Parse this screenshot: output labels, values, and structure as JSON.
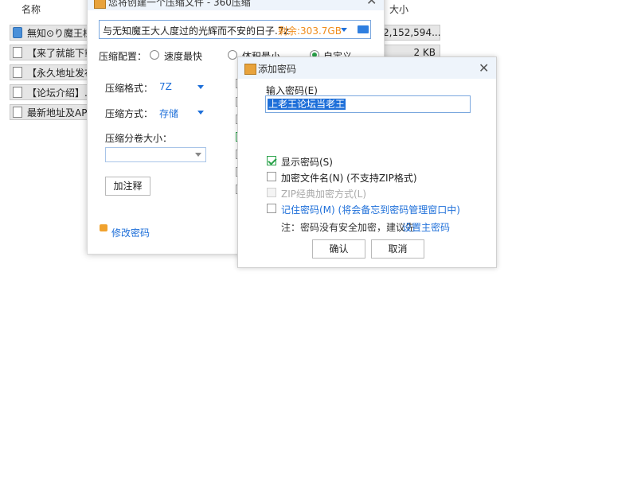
{
  "file_list": {
    "col_name": "名称",
    "col_size": "大小",
    "rows": [
      {
        "name": "無知⊙り魔王様",
        "size": "2,152,594..."
      },
      {
        "name": "【来了就能下载",
        "size": "2 KB"
      },
      {
        "name": "【永久地址发布",
        "size": ""
      },
      {
        "name": "【论坛介绍】.tx",
        "size": ""
      },
      {
        "name": "最新地址及APP",
        "size": ""
      }
    ]
  },
  "compress_dialog": {
    "title": "您将创建一个压缩文件 - 360压缩",
    "filename": "与无知魔王大人度过的光辉而不安的日子.7z",
    "free_space": "剩余:303.7GB",
    "config_label": "压缩配置：",
    "config_options": [
      "速度最快",
      "体积最小",
      "自定义"
    ],
    "format_label": "压缩格式：",
    "format_value": "7Z",
    "method_label": "压缩方式：",
    "method_value": "存储",
    "split_label": "压缩分卷大小：",
    "split_value": "",
    "comment_button": "加注释",
    "change_password": "修改密码"
  },
  "password_dialog": {
    "title": "添加密码",
    "input_label": "输入密码(E)",
    "password_value": "上老王论坛当老王",
    "show_password": "显示密码(S)",
    "encrypt_names": "加密文件名(N) (不支持ZIP格式)",
    "zip_classic": "ZIP经典加密方式(L)",
    "remember_password": "记住密码(M) (将会备忘到密码管理窗口中)",
    "note_prefix": "注：密码没有安全加密，建议先",
    "note_link": "设置主密码",
    "ok_button": "确认",
    "cancel_button": "取消"
  },
  "colors": {
    "accent": "#1e6fd9",
    "warning": "#f08c1a",
    "check": "#2aa24a"
  }
}
